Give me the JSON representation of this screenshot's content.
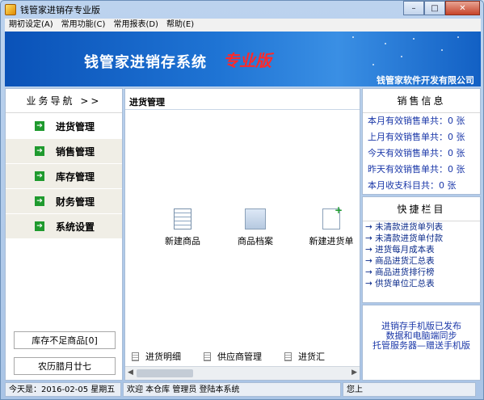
{
  "window": {
    "title": "钱管家进销存专业版",
    "controls": {
      "minimize": "–",
      "maximize": "□",
      "close": "✕"
    }
  },
  "menu": [
    "期初设定(A)",
    "常用功能(C)",
    "常用报表(D)",
    "帮助(E)"
  ],
  "banner": {
    "title": "钱管家进销存系统",
    "edition": "专业版",
    "company": "钱管家软件开发有限公司"
  },
  "nav": {
    "header": "业务导航 >>",
    "items": [
      "进货管理",
      "销售管理",
      "库存管理",
      "财务管理",
      "系统设置"
    ],
    "stock_button": "库存不足商品[0]",
    "lunar_date": "农历腊月廿七"
  },
  "main": {
    "title": "进货管理",
    "tiles": [
      "新建商品",
      "商品档案",
      "新建进货单"
    ],
    "bottom_tabs": [
      "进货明细",
      "供应商管理",
      "进货汇"
    ]
  },
  "sales": {
    "header": "销售信息",
    "lines": [
      "本月有效销售单共：0 张",
      "上月有效销售单共：0 张",
      "今天有效销售单共：0 张",
      "昨天有效销售单共：0 张",
      "本月收支科目共：0 张"
    ]
  },
  "quick": {
    "header": "快捷栏目",
    "items": [
      "未清款进货单列表",
      "未清款进货单付款",
      "进货每月成本表",
      "商品进货汇总表",
      "商品进货排行榜",
      "供货单位汇总表"
    ]
  },
  "promo": {
    "lines": [
      "进销存手机版已发布",
      "数据和电脑端同步",
      "托管服务器—赠送手机版"
    ]
  },
  "status": {
    "today": "今天是：2016-02-05  星期五",
    "welcome": "欢迎 本仓库 管理员  登陆本系统",
    "right": "您上"
  },
  "colors": {
    "banner": "#1f74d4",
    "edition": "#ff2a2a",
    "nav_arrow": "#1f9a2e",
    "link": "#1a37a8"
  }
}
